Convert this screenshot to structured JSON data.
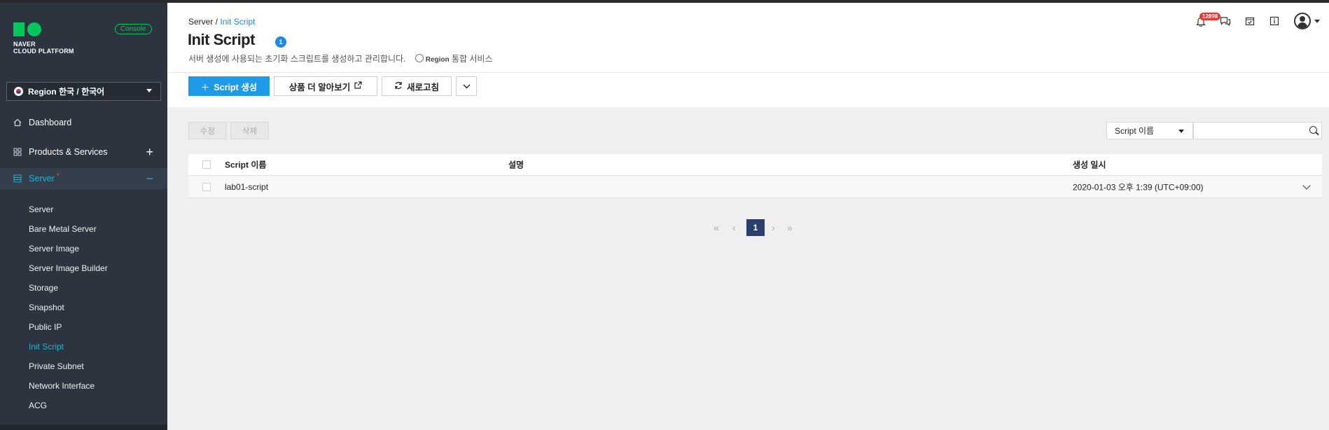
{
  "sidebar": {
    "logo_line1": "NAVER",
    "logo_line2": "CLOUD PLATFORM",
    "console_label": "Console",
    "region_label": "Region 한국 / 한국어",
    "nav": [
      {
        "label": "Dashboard",
        "icon": "home-icon"
      },
      {
        "label": "Products & Services",
        "icon": "grid-icon"
      },
      {
        "label": "Server",
        "icon": "server-icon",
        "badge": "*"
      }
    ],
    "sub_items": [
      "Server",
      "Bare Metal Server",
      "Server Image",
      "Server Image Builder",
      "Storage",
      "Snapshot",
      "Public IP",
      "Init Script",
      "Private Subnet",
      "Network Interface",
      "ACG"
    ],
    "active_sub": "Init Script"
  },
  "header": {
    "breadcrumb_root": "Server /",
    "breadcrumb_current": "Init Script",
    "title": "Init Script",
    "count": "1",
    "description": "서버 생성에 사용되는 초기화 스크립트를 생성하고 관리합니다.",
    "region_word": "Region",
    "region_note": "통합 서비스",
    "notification_count": "12898"
  },
  "toolbar": {
    "create_label": "Script 생성",
    "learn_more_label": "상품 더 알아보기",
    "refresh_label": "새로고침"
  },
  "actions": {
    "edit_label": "수정",
    "delete_label": "삭제"
  },
  "search": {
    "field_selected": "Script 이름",
    "query": ""
  },
  "table": {
    "columns": [
      "Script 이름",
      "설명",
      "생성 일시"
    ],
    "rows": [
      {
        "name": "lab01-script",
        "description": "",
        "created": "2020-01-03 오후 1:39 (UTC+09:00)"
      }
    ]
  },
  "pagination": {
    "current_page": "1"
  },
  "colors": {
    "sidebar_bg": "#2c3440",
    "accent": "#1fb3d6",
    "primary_button": "#1e9be8",
    "brand_green": "#03c75a",
    "pager_active": "#2c3e70"
  }
}
